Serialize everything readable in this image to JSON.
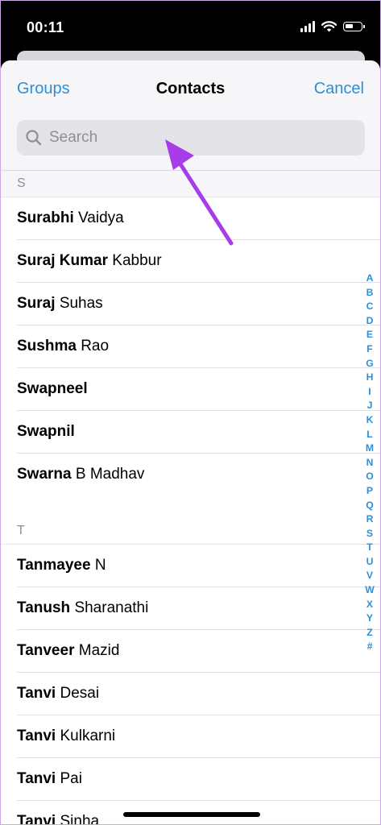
{
  "status": {
    "time": "00:11"
  },
  "nav": {
    "left": "Groups",
    "title": "Contacts",
    "right": "Cancel"
  },
  "search": {
    "placeholder": "Search"
  },
  "sections": [
    {
      "letter": "S",
      "contacts": [
        {
          "first": "Surabhi",
          "last": "Vaidya"
        },
        {
          "first": "Suraj Kumar",
          "last": "Kabbur"
        },
        {
          "first": "Suraj",
          "last": "Suhas"
        },
        {
          "first": "Sushma",
          "last": "Rao"
        },
        {
          "first": "Swapneel",
          "last": ""
        },
        {
          "first": "Swapnil",
          "last": ""
        },
        {
          "first": "Swarna",
          "last": "B Madhav"
        }
      ]
    },
    {
      "letter": "T",
      "contacts": [
        {
          "first": "Tanmayee",
          "last": "N"
        },
        {
          "first": "Tanush",
          "last": "Sharanathi"
        },
        {
          "first": "Tanveer",
          "last": "Mazid"
        },
        {
          "first": "Tanvi",
          "last": "Desai"
        },
        {
          "first": "Tanvi",
          "last": "Kulkarni"
        },
        {
          "first": "Tanvi",
          "last": "Pai"
        },
        {
          "first": "Tanvi",
          "last": "Sinha"
        }
      ]
    }
  ],
  "index_letters": [
    "A",
    "B",
    "C",
    "D",
    "E",
    "F",
    "G",
    "H",
    "I",
    "J",
    "K",
    "L",
    "M",
    "N",
    "O",
    "P",
    "Q",
    "R",
    "S",
    "T",
    "U",
    "V",
    "W",
    "X",
    "Y",
    "Z",
    "#"
  ],
  "colors": {
    "accent": "#2e8fd6",
    "annotation_arrow": "#a63de8"
  }
}
